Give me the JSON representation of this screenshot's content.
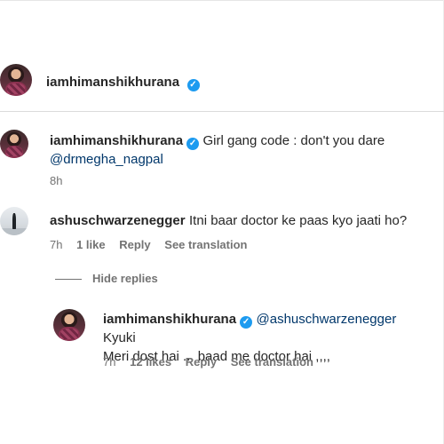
{
  "post_header": {
    "username": "iamhimanshikhurana"
  },
  "comments": [
    {
      "username": "iamhimanshikhurana",
      "text": "Girl gang code : don't you dare",
      "mention": "@drmegha_nagpal",
      "time": "8h"
    },
    {
      "username": "ashuschwarzenegger",
      "text": "Itni baar doctor ke paas kyo jaati ho?",
      "time": "7h",
      "likes": "1 like",
      "reply_label": "Reply",
      "translation_label": "See translation"
    }
  ],
  "hide_replies_label": "Hide replies",
  "reply": {
    "username": "iamhimanshikhurana",
    "mention": "@ashuschwarzenegger",
    "text_line1": "Kyuki",
    "text_line2": "Meri dost hai ... baad me doctor hai ,,,,",
    "time": "7h",
    "likes": "12 likes",
    "reply_label": "Reply",
    "translation_label": "See translation"
  },
  "colors": {
    "verified": "#1d9bf0",
    "mention": "#00376b",
    "meta": "#737373"
  }
}
